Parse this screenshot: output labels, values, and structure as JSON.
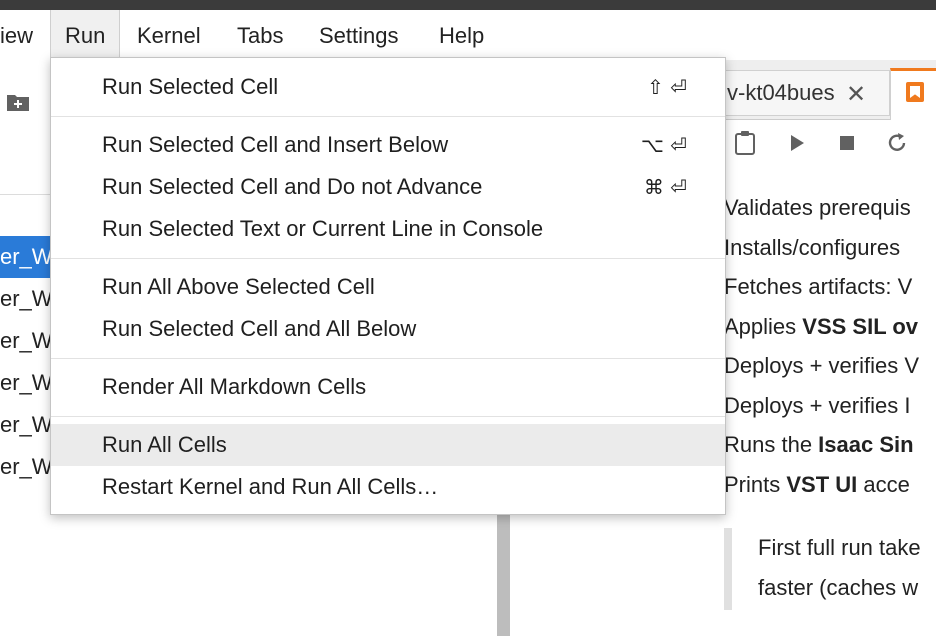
{
  "menubar": {
    "items": [
      "iew",
      "Run",
      "Kernel",
      "Tabs",
      "Settings",
      "Help"
    ],
    "active": "Run"
  },
  "run_menu": {
    "groups": [
      [
        {
          "label": "Run Selected Cell",
          "shortcut": "⇧ ⏎"
        }
      ],
      [
        {
          "label": "Run Selected Cell and Insert Below",
          "shortcut": "⌥ ⏎"
        },
        {
          "label": "Run Selected Cell and Do not Advance",
          "shortcut": "⌘ ⏎"
        },
        {
          "label": "Run Selected Text or Current Line in Console",
          "shortcut": ""
        }
      ],
      [
        {
          "label": "Run All Above Selected Cell",
          "shortcut": ""
        },
        {
          "label": "Run Selected Cell and All Below",
          "shortcut": ""
        }
      ],
      [
        {
          "label": "Render All Markdown Cells",
          "shortcut": ""
        }
      ],
      [
        {
          "label": "Run All Cells",
          "shortcut": "",
          "hovered": true
        },
        {
          "label": "Restart Kernel and Run All Cells…",
          "shortcut": ""
        }
      ]
    ]
  },
  "file_browser": {
    "rows": [
      "er_Wo",
      "er_Wo",
      "er_Wo",
      "er_Wo",
      "er_Wo",
      "er_Wo"
    ],
    "selected_index": 0
  },
  "notebook": {
    "tab_label": "v-kt04bues",
    "content_lines": [
      {
        "plain": "Validates prerequis",
        "bold": ""
      },
      {
        "plain": "Installs/configures",
        "bold": ""
      },
      {
        "plain": "Fetches artifacts: V",
        "bold": ""
      },
      {
        "plain": "Applies ",
        "bold": "VSS SIL ov"
      },
      {
        "plain": "Deploys + verifies V",
        "bold": ""
      },
      {
        "plain": "Deploys + verifies I",
        "bold": ""
      },
      {
        "plain": "Runs the ",
        "bold": "Isaac Sin"
      },
      {
        "plain": "Prints ",
        "bold": "VST UI",
        "after": " acce"
      }
    ],
    "quote_lines": [
      "First full run take",
      "faster (caches w"
    ]
  },
  "colors": {
    "accent_selection": "#2a7bd8",
    "active_tab": "#f07a1e"
  }
}
